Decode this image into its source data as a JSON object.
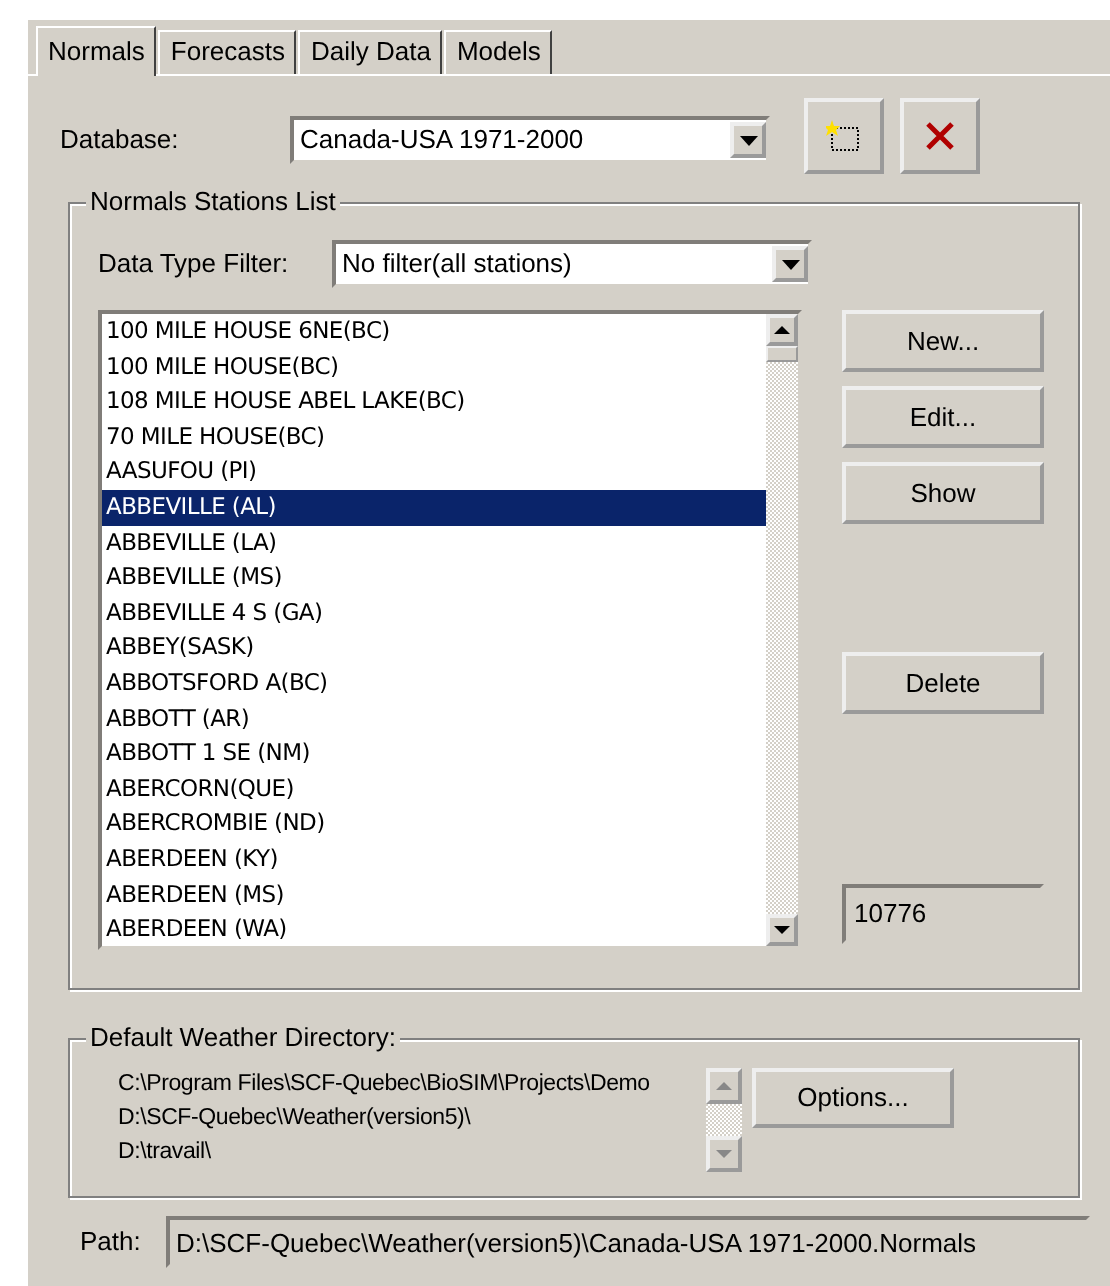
{
  "tabs": [
    {
      "label": "Normals",
      "selected": true
    },
    {
      "label": "Forecasts",
      "selected": false
    },
    {
      "label": "Daily Data",
      "selected": false
    },
    {
      "label": "Models",
      "selected": false
    }
  ],
  "database": {
    "label": "Database:",
    "value": "Canada-USA 1971-2000"
  },
  "stations": {
    "title": "Normals Stations List",
    "filter_label": "Data Type Filter:",
    "filter_value": "No filter(all stations)",
    "items": [
      {
        "name": "100 MILE HOUSE 6NE(BC)",
        "selected": false
      },
      {
        "name": "100 MILE HOUSE(BC)",
        "selected": false
      },
      {
        "name": "108 MILE HOUSE ABEL LAKE(BC)",
        "selected": false
      },
      {
        "name": "70 MILE HOUSE(BC)",
        "selected": false
      },
      {
        "name": "AASUFOU (PI)",
        "selected": false
      },
      {
        "name": "ABBEVILLE (AL)",
        "selected": true
      },
      {
        "name": "ABBEVILLE (LA)",
        "selected": false
      },
      {
        "name": "ABBEVILLE (MS)",
        "selected": false
      },
      {
        "name": "ABBEVILLE 4 S (GA)",
        "selected": false
      },
      {
        "name": "ABBEY(SASK)",
        "selected": false
      },
      {
        "name": "ABBOTSFORD A(BC)",
        "selected": false
      },
      {
        "name": "ABBOTT (AR)",
        "selected": false
      },
      {
        "name": "ABBOTT 1 SE (NM)",
        "selected": false
      },
      {
        "name": "ABERCORN(QUE)",
        "selected": false
      },
      {
        "name": "ABERCROMBIE (ND)",
        "selected": false
      },
      {
        "name": "ABERDEEN (KY)",
        "selected": false
      },
      {
        "name": "ABERDEEN (MS)",
        "selected": false
      },
      {
        "name": "ABERDEEN (WA)",
        "selected": false
      }
    ],
    "actions": [
      "New...",
      "Edit...",
      "Show",
      "Delete"
    ],
    "count": "10776"
  },
  "weather_directory": {
    "title": "Default Weather Directory:",
    "paths": [
      "C:\\Program Files\\SCF-Quebec\\BioSIM\\Projects\\Demo",
      "D:\\SCF-Quebec\\Weather(version5)\\",
      "D:\\travail\\"
    ],
    "button": "Options..."
  },
  "path": {
    "label": "Path:",
    "value": "D:\\SCF-Quebec\\Weather(version5)\\Canada-USA 1971-2000.Normals"
  }
}
